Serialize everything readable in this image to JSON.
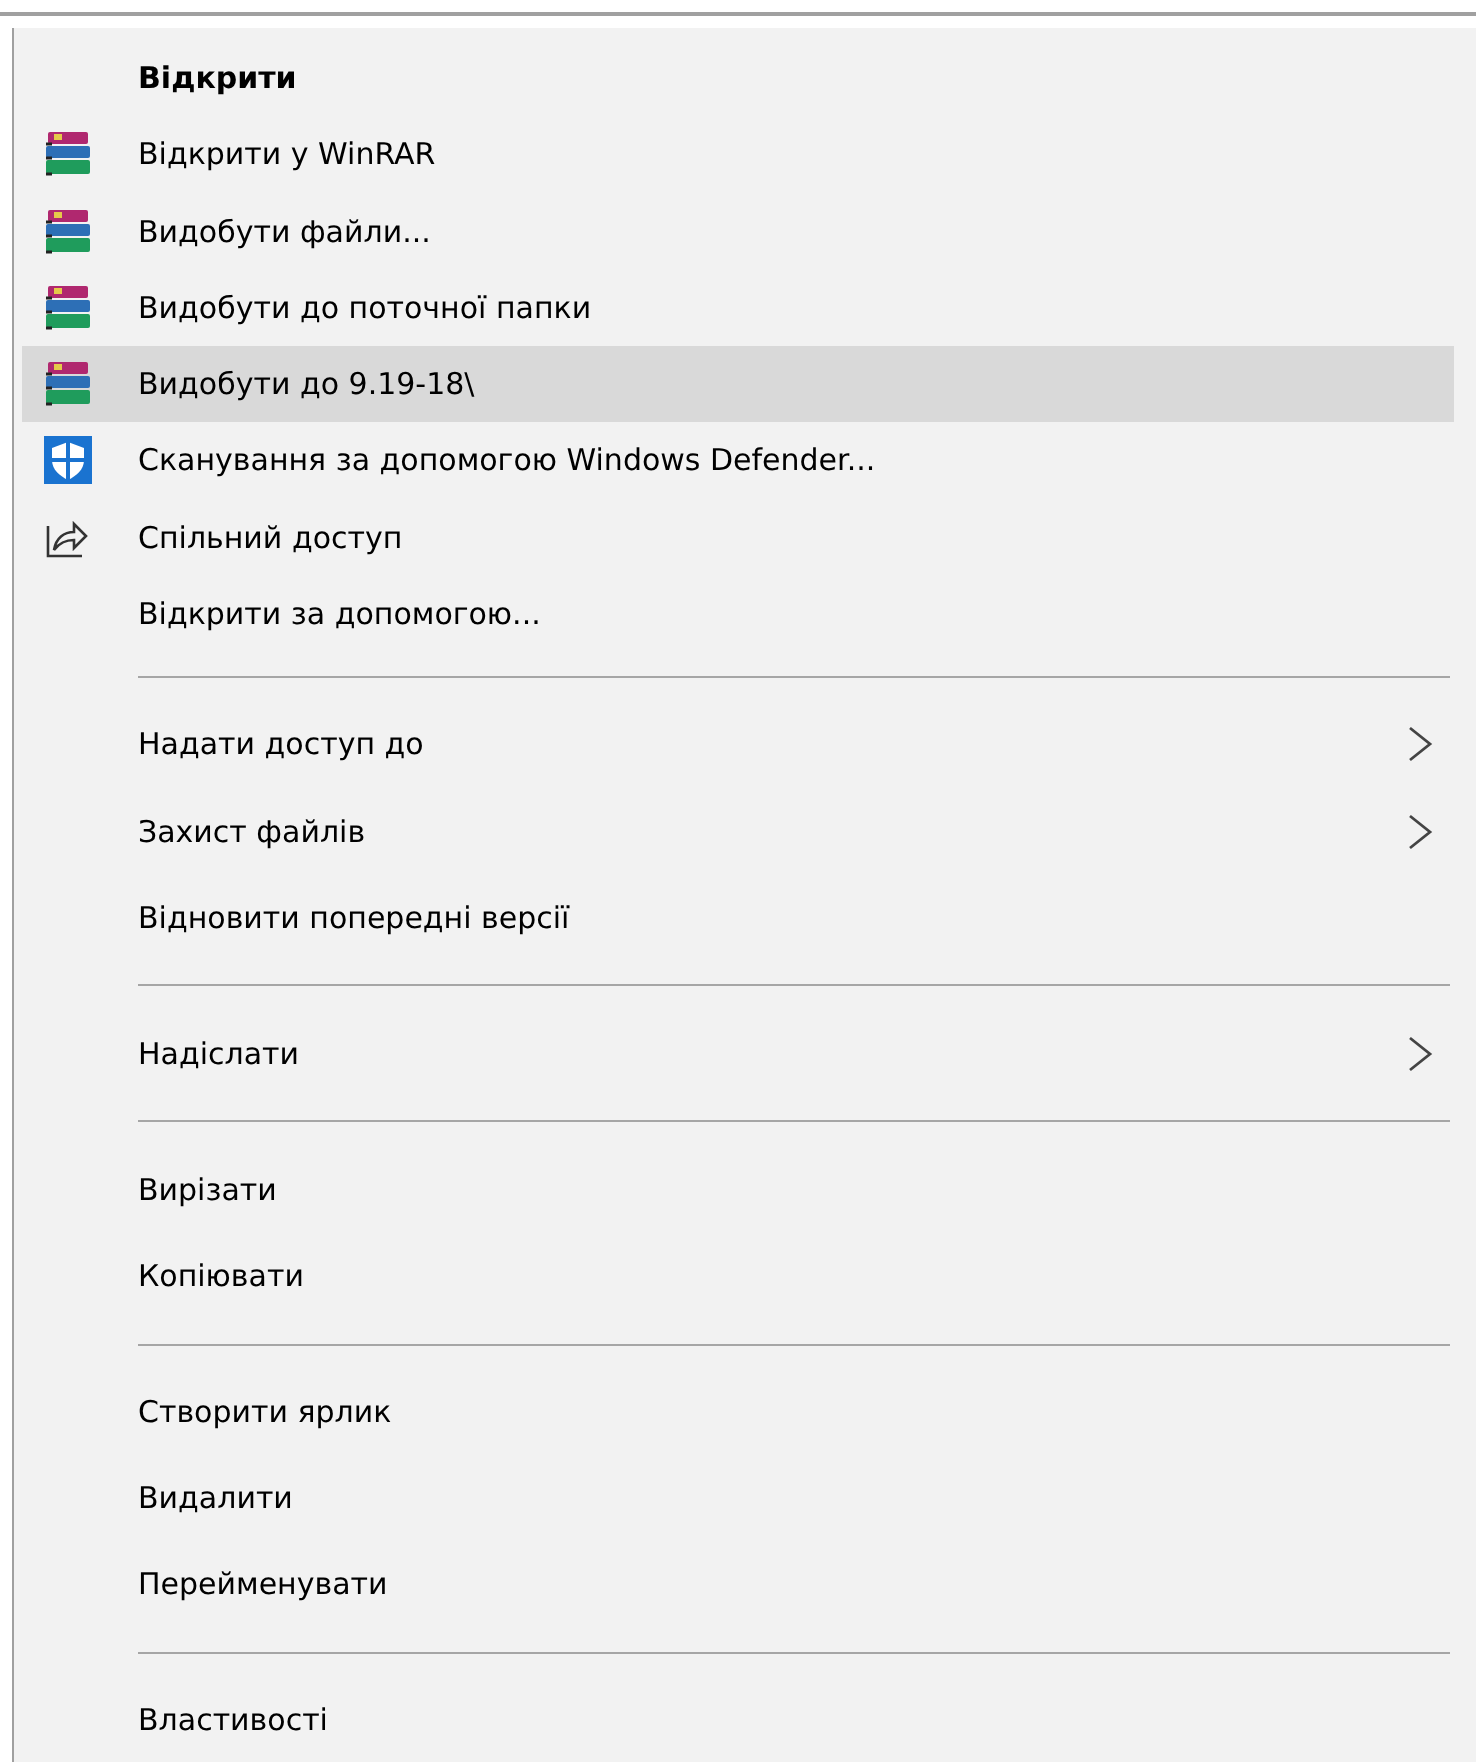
{
  "menu": {
    "sections": [
      {
        "items": [
          {
            "label": "Відкрити",
            "bold": true,
            "kind": "plain",
            "submenu": false,
            "selected": false
          },
          {
            "label": "Відкрити у WinRAR",
            "bold": false,
            "kind": "books",
            "submenu": false,
            "selected": false
          },
          {
            "label": "Видобути файли...",
            "bold": false,
            "kind": "books",
            "submenu": false,
            "selected": false
          },
          {
            "label": "Видобути до поточної папки",
            "bold": false,
            "kind": "books",
            "submenu": false,
            "selected": false
          },
          {
            "label": "Видобути до 9.19-18\\",
            "bold": false,
            "kind": "books",
            "submenu": false,
            "selected": true
          },
          {
            "label": "Сканування за допомогою Windows Defender...",
            "bold": false,
            "kind": "shield",
            "submenu": false,
            "selected": false
          },
          {
            "label": "Спільний доступ",
            "bold": false,
            "kind": "share",
            "submenu": false,
            "selected": false
          },
          {
            "label": "Відкрити за допомогою...",
            "bold": false,
            "kind": "plain",
            "submenu": false,
            "selected": false
          }
        ]
      },
      {
        "items": [
          {
            "label": "Надати доступ до",
            "bold": false,
            "kind": "plain",
            "submenu": true,
            "selected": false
          },
          {
            "label": "Захист файлів",
            "bold": false,
            "kind": "plain",
            "submenu": true,
            "selected": false
          },
          {
            "label": "Відновити попередні версії",
            "bold": false,
            "kind": "plain",
            "submenu": false,
            "selected": false
          }
        ]
      },
      {
        "items": [
          {
            "label": "Надіслати",
            "bold": false,
            "kind": "plain",
            "submenu": true,
            "selected": false
          }
        ]
      },
      {
        "items": [
          {
            "label": "Вирізати",
            "bold": false,
            "kind": "plain",
            "submenu": false,
            "selected": false
          },
          {
            "label": "Копіювати",
            "bold": false,
            "kind": "plain",
            "submenu": false,
            "selected": false
          }
        ]
      },
      {
        "items": [
          {
            "label": "Створити ярлик",
            "bold": false,
            "kind": "plain",
            "submenu": false,
            "selected": false
          },
          {
            "label": "Видалити",
            "bold": false,
            "kind": "plain",
            "submenu": false,
            "selected": false
          },
          {
            "label": "Перейменувати",
            "bold": false,
            "kind": "plain",
            "submenu": false,
            "selected": false
          }
        ]
      },
      {
        "items": [
          {
            "label": "Властивості",
            "bold": false,
            "kind": "plain",
            "submenu": false,
            "selected": false
          }
        ]
      }
    ]
  }
}
